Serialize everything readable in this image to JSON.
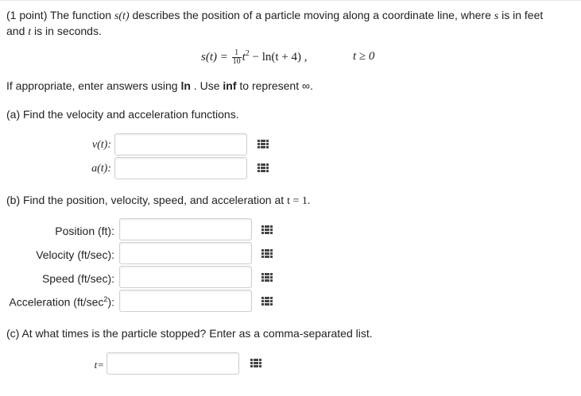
{
  "intro": {
    "line1_prefix": "(1 point) The function ",
    "s_of_t": "s(t)",
    "line1_middle": " describes the position of a particle moving along a coordinate line, where ",
    "s": "s",
    "line1_suffix": " is in feet",
    "line2_prefix": "and ",
    "t": "t",
    "line2_suffix": " is in seconds."
  },
  "formula": {
    "lhs": "s(t) =",
    "frac_num": "1",
    "frac_den": "10",
    "t_sq": "t",
    "exp": "2",
    "rest": " − ln(t + 4) ,",
    "condition": "t ≥ 0"
  },
  "instructions": {
    "prefix": "If appropriate, enter answers using ",
    "ln": "ln",
    "middle": " . Use ",
    "inf": "inf",
    "suffix": " to represent ∞."
  },
  "part_a": {
    "title": "(a) Find the velocity and acceleration functions.",
    "v_label": "v(t):",
    "a_label": "a(t):"
  },
  "part_b": {
    "title_prefix": "(b) Find the position, velocity, speed, and acceleration at ",
    "title_math": "t = 1.",
    "position_label": "Position (ft):",
    "velocity_label": "Velocity (ft/sec):",
    "speed_label": "Speed (ft/sec):",
    "accel_label_prefix": "Acceleration (ft/sec",
    "accel_sup": "2",
    "accel_label_suffix": "):"
  },
  "part_c": {
    "title": "(c) At what times is the particle stopped? Enter as a comma-separated list.",
    "t_label": "t="
  }
}
